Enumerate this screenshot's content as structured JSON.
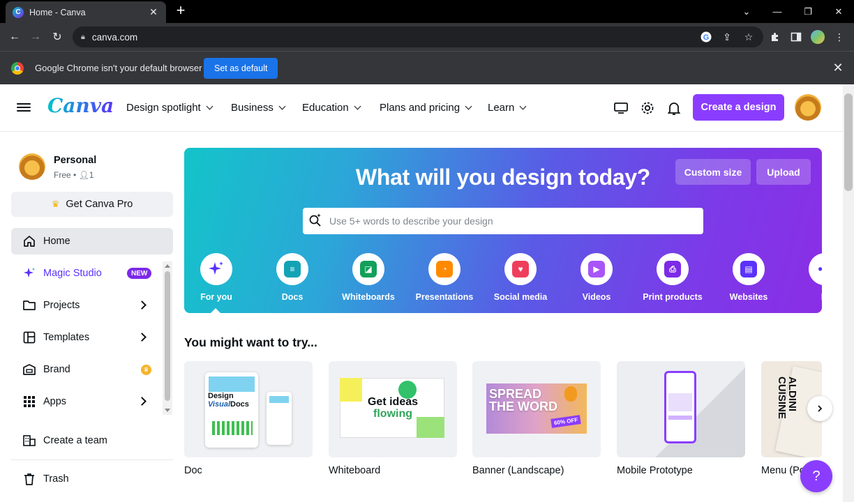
{
  "browser": {
    "tab_title": "Home - Canva",
    "url": "canva.com",
    "infobar_text": "Google Chrome isn't your default browser",
    "set_default_label": "Set as default"
  },
  "header": {
    "logo": "Canva",
    "nav": [
      "Design spotlight",
      "Business",
      "Education",
      "Plans and pricing",
      "Learn"
    ],
    "create_label": "Create a design"
  },
  "account": {
    "name": "Personal",
    "plan": "Free",
    "members": "1",
    "get_pro_label": "Get Canva Pro"
  },
  "sidebar": {
    "items": [
      {
        "label": "Home",
        "icon": "home-icon"
      },
      {
        "label": "Magic Studio",
        "icon": "magic-sparkle-icon",
        "badge": "NEW"
      },
      {
        "label": "Projects",
        "icon": "folder-icon"
      },
      {
        "label": "Templates",
        "icon": "templates-icon"
      },
      {
        "label": "Brand",
        "icon": "brand-icon"
      },
      {
        "label": "Apps",
        "icon": "apps-grid-icon"
      }
    ],
    "create_team_label": "Create a team",
    "trash_label": "Trash"
  },
  "hero": {
    "title": "What will you design today?",
    "custom_size_label": "Custom size",
    "upload_label": "Upload",
    "search_placeholder": "Use 5+ words to describe your design",
    "categories": [
      {
        "label": "For you",
        "color": "#5a32fa"
      },
      {
        "label": "Docs",
        "color": "#13a3b5"
      },
      {
        "label": "Whiteboards",
        "color": "#12a05a"
      },
      {
        "label": "Presentations",
        "color": "#ff8a00"
      },
      {
        "label": "Social media",
        "color": "#ef3e5c"
      },
      {
        "label": "Videos",
        "color": "#a855f7"
      },
      {
        "label": "Print products",
        "color": "#7d2ae8"
      },
      {
        "label": "Websites",
        "color": "#5a32fa"
      },
      {
        "label": "M",
        "color": "#5a32fa"
      }
    ]
  },
  "suggestions": {
    "title": "You might want to try...",
    "cards": [
      {
        "label": "Doc",
        "thumb_text_1": "Design",
        "thumb_text_2": "Visual",
        "thumb_text_3": "Docs"
      },
      {
        "label": "Whiteboard",
        "thumb_text_1": "Get ideas",
        "thumb_text_2": "flowing"
      },
      {
        "label": "Banner (Landscape)",
        "thumb_text_1": "SPREAD",
        "thumb_text_2": "THE WORD",
        "thumb_text_3": "60% OFF"
      },
      {
        "label": "Mobile Prototype"
      },
      {
        "label": "Menu (Po",
        "thumb_text_1": "ALDINI",
        "thumb_text_2": "CUISINE"
      }
    ]
  },
  "help_label": "?"
}
